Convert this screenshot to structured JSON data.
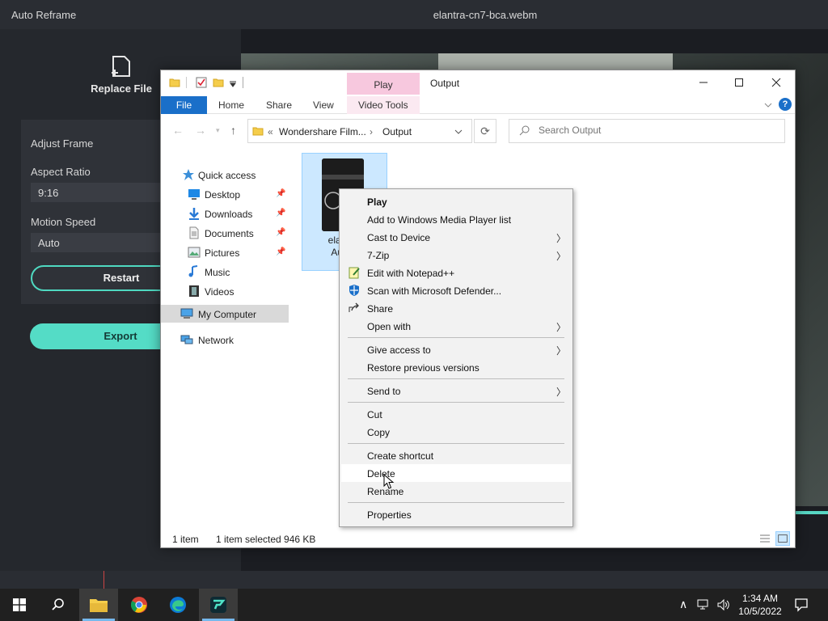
{
  "app": {
    "title": "Auto Reframe",
    "file_title": "elantra-cn7-bca.webm",
    "replace_file": "Replace File",
    "adjust_frame": "Adjust Frame",
    "aspect_ratio_label": "Aspect Ratio",
    "aspect_ratio_value": "9:16",
    "motion_speed_label": "Motion Speed",
    "motion_speed_value": "Auto",
    "restart": "Restart",
    "export": "Export",
    "accent_color": "#54dcc6"
  },
  "explorer": {
    "play_tab": "Play",
    "title": "Output",
    "ribbon_tabs": [
      "File",
      "Home",
      "Share",
      "View",
      "Video Tools"
    ],
    "breadcrumb": [
      "Wondershare Film...",
      "Output"
    ],
    "search_placeholder": "Search Output",
    "nav": [
      {
        "label": "Quick access",
        "icon": "star-icon"
      },
      {
        "label": "Desktop",
        "icon": "desktop-icon",
        "pinned": true
      },
      {
        "label": "Downloads",
        "icon": "download-icon",
        "pinned": true
      },
      {
        "label": "Documents",
        "icon": "document-icon",
        "pinned": true
      },
      {
        "label": "Pictures",
        "icon": "picture-icon",
        "pinned": true
      },
      {
        "label": "Music",
        "icon": "music-icon"
      },
      {
        "label": "Videos",
        "icon": "video-icon"
      },
      {
        "label": "My Computer",
        "icon": "computer-icon",
        "selected": true
      },
      {
        "label": "Network",
        "icon": "network-icon"
      }
    ],
    "file": {
      "name_line1": "elantra-",
      "name_line2": "AutoR"
    },
    "status": {
      "items": "1 item",
      "selected": "1 item selected  946 KB"
    },
    "accent_color": "#1a6fc9"
  },
  "context_menu": {
    "items": [
      {
        "label": "Play",
        "bold": true
      },
      {
        "label": "Add to Windows Media Player list"
      },
      {
        "label": "Cast to Device",
        "submenu": true
      },
      {
        "label": "7-Zip",
        "submenu": true
      },
      {
        "label": "Edit with Notepad++",
        "icon": "notepad-icon"
      },
      {
        "label": "Scan with Microsoft Defender...",
        "icon": "defender-icon"
      },
      {
        "label": "Share",
        "icon": "share-icon"
      },
      {
        "label": "Open with",
        "submenu": true
      },
      {
        "label": "Give access to",
        "submenu": true
      },
      {
        "label": "Restore previous versions"
      },
      {
        "label": "Send to",
        "submenu": true
      },
      {
        "label": "Cut"
      },
      {
        "label": "Copy"
      },
      {
        "label": "Create shortcut"
      },
      {
        "label": "Delete",
        "hover": true
      },
      {
        "label": "Rename"
      },
      {
        "label": "Properties"
      }
    ]
  },
  "taskbar": {
    "time": "1:34 AM",
    "date": "10/5/2022"
  }
}
